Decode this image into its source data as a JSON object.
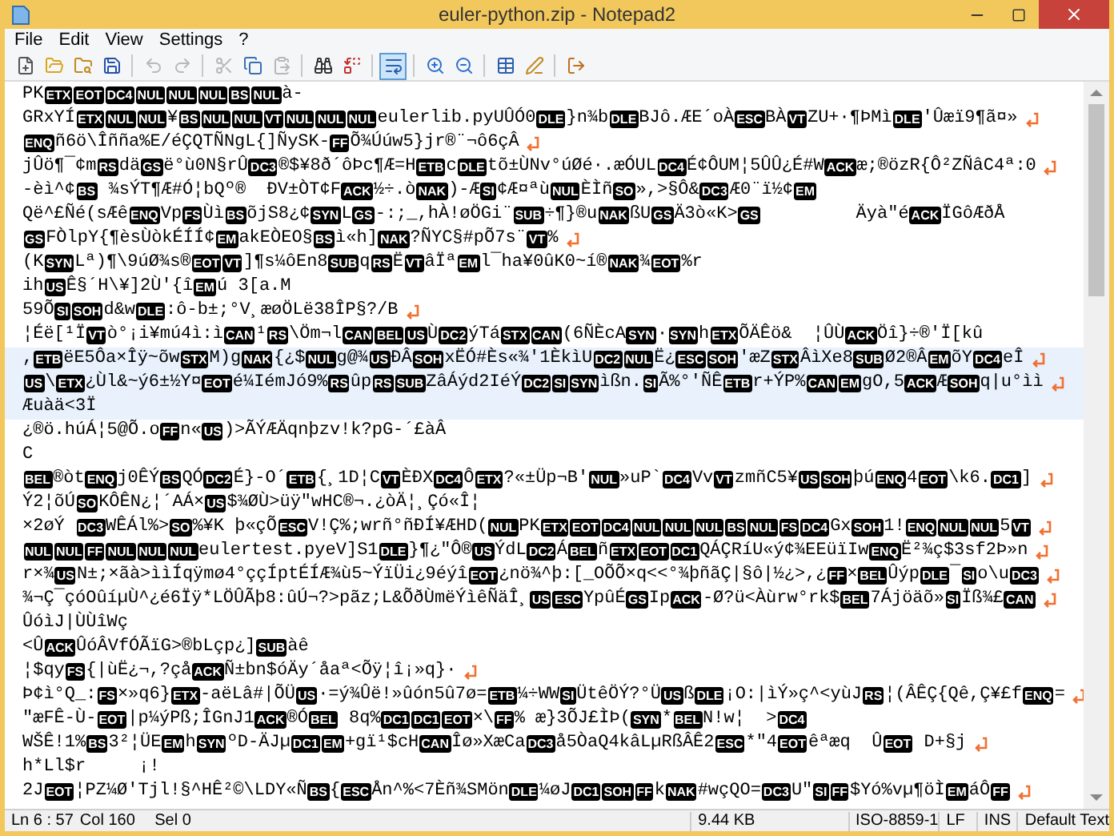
{
  "window": {
    "title": "euler-python.zip - Notepad2"
  },
  "menu": [
    {
      "label": "File"
    },
    {
      "label": "Edit"
    },
    {
      "label": "View"
    },
    {
      "label": "Settings"
    },
    {
      "label": "?"
    }
  ],
  "toolbar": [
    {
      "kind": "new",
      "pressed": false,
      "disabled": false
    },
    {
      "kind": "open",
      "pressed": false,
      "disabled": false
    },
    {
      "kind": "browse",
      "pressed": false,
      "disabled": false
    },
    {
      "kind": "save",
      "pressed": false,
      "disabled": false
    },
    {
      "kind": "sep"
    },
    {
      "kind": "undo",
      "pressed": false,
      "disabled": true
    },
    {
      "kind": "redo",
      "pressed": false,
      "disabled": true
    },
    {
      "kind": "sep"
    },
    {
      "kind": "cut",
      "pressed": false,
      "disabled": true
    },
    {
      "kind": "copy",
      "pressed": false,
      "disabled": false
    },
    {
      "kind": "paste",
      "pressed": false,
      "disabled": true
    },
    {
      "kind": "sep"
    },
    {
      "kind": "find",
      "pressed": false,
      "disabled": false
    },
    {
      "kind": "replace",
      "pressed": false,
      "disabled": false
    },
    {
      "kind": "sep"
    },
    {
      "kind": "wrap",
      "pressed": true,
      "disabled": false
    },
    {
      "kind": "sep"
    },
    {
      "kind": "zoomin",
      "pressed": false,
      "disabled": false
    },
    {
      "kind": "zoomout",
      "pressed": false,
      "disabled": false
    },
    {
      "kind": "sep"
    },
    {
      "kind": "schemes",
      "pressed": false,
      "disabled": false
    },
    {
      "kind": "customize",
      "pressed": false,
      "disabled": false
    },
    {
      "kind": "sep"
    },
    {
      "kind": "exit",
      "pressed": false,
      "disabled": false
    }
  ],
  "rows": [
    {
      "wrapped": false,
      "current": false,
      "parts": [
        {
          "kind": "text",
          "text": "PK"
        },
        {
          "kind": "control",
          "text": "ETX"
        },
        {
          "kind": "control",
          "text": "EOT"
        },
        {
          "kind": "control",
          "text": "DC4"
        },
        {
          "kind": "control",
          "text": "NUL"
        },
        {
          "kind": "control",
          "text": "NUL"
        },
        {
          "kind": "control",
          "text": "NUL"
        },
        {
          "kind": "control",
          "text": "BS"
        },
        {
          "kind": "control",
          "text": "NUL"
        },
        {
          "kind": "text",
          "text": "à-"
        }
      ]
    },
    {
      "wrapped": true,
      "current": false,
      "parts": [
        {
          "kind": "text",
          "text": "GRxYÍ"
        },
        {
          "kind": "control",
          "text": "ETX"
        },
        {
          "kind": "control",
          "text": "NUL"
        },
        {
          "kind": "control",
          "text": "NUL"
        },
        {
          "kind": "text",
          "text": "¥"
        },
        {
          "kind": "control",
          "text": "BS"
        },
        {
          "kind": "control",
          "text": "NUL"
        },
        {
          "kind": "control",
          "text": "NUL"
        },
        {
          "kind": "control",
          "text": "VT"
        },
        {
          "kind": "control",
          "text": "NUL"
        },
        {
          "kind": "control",
          "text": "NUL"
        },
        {
          "kind": "control",
          "text": "NUL"
        },
        {
          "kind": "text",
          "text": "eulerlib.pyUÛÓ0"
        },
        {
          "kind": "control",
          "text": "DLE"
        },
        {
          "kind": "text",
          "text": "}n¾b"
        },
        {
          "kind": "control",
          "text": "DLE"
        },
        {
          "kind": "text",
          "text": "BJô.ÆE´oÀ"
        },
        {
          "kind": "control",
          "text": "ESC"
        },
        {
          "kind": "text",
          "text": "BÀ"
        },
        {
          "kind": "control",
          "text": "VT"
        },
        {
          "kind": "text",
          "text": "ZU+·¶ÞMì"
        },
        {
          "kind": "control",
          "text": "DLE"
        },
        {
          "kind": "text",
          "text": "'Ûæï9¶ã¤»"
        }
      ]
    },
    {
      "wrapped": true,
      "current": false,
      "parts": [
        {
          "kind": "control",
          "text": "ENQ"
        },
        {
          "kind": "text",
          "text": "ñ6ö\\Îñña%E/éÇQTÑNgL{]ÑySK-"
        },
        {
          "kind": "control",
          "text": "FF"
        },
        {
          "kind": "text",
          "text": "Õ¾Úúw5}jr®¨¬ô6çÂ"
        }
      ]
    },
    {
      "wrapped": true,
      "current": false,
      "parts": [
        {
          "kind": "text",
          "text": "jÛö¶¯¢m"
        },
        {
          "kind": "control",
          "text": "RS"
        },
        {
          "kind": "text",
          "text": "dä"
        },
        {
          "kind": "control",
          "text": "GS"
        },
        {
          "kind": "text",
          "text": "ë°ù0N§rÛ"
        },
        {
          "kind": "control",
          "text": "DC3"
        },
        {
          "kind": "text",
          "text": "®$¥8ð´ôÞc¶Æ=H"
        },
        {
          "kind": "control",
          "text": "ETB"
        },
        {
          "kind": "text",
          "text": "c"
        },
        {
          "kind": "control",
          "text": "DLE"
        },
        {
          "kind": "text",
          "text": "tõ±ÙNv°úØé·.æÓUL"
        },
        {
          "kind": "control",
          "text": "DC4"
        },
        {
          "kind": "text",
          "text": "É¢ÔUM¦5ÛÛ¿É#W"
        },
        {
          "kind": "control",
          "text": "ACK"
        },
        {
          "kind": "text",
          "text": "æ;®özR{Ô²ZÑâC4ª:0"
        }
      ]
    },
    {
      "wrapped": false,
      "current": false,
      "parts": [
        {
          "kind": "text",
          "text": "-èì^¢"
        },
        {
          "kind": "control",
          "text": "BS"
        },
        {
          "kind": "text",
          "text": " ¾sÝT¶Æ#Ó¦bQº®  ÐV±ÒT¢F"
        },
        {
          "kind": "control",
          "text": "ACK"
        },
        {
          "kind": "text",
          "text": "½÷.ò"
        },
        {
          "kind": "control",
          "text": "NAK"
        },
        {
          "kind": "text",
          "text": ")-Æ"
        },
        {
          "kind": "control",
          "text": "SI"
        },
        {
          "kind": "text",
          "text": "¢Æ¤ªù"
        },
        {
          "kind": "control",
          "text": "NUL"
        },
        {
          "kind": "text",
          "text": "ÈÌñ"
        },
        {
          "kind": "control",
          "text": "SO"
        },
        {
          "kind": "text",
          "text": "»,>§Ô&"
        },
        {
          "kind": "control",
          "text": "DC3"
        },
        {
          "kind": "text",
          "text": "Æ0¨ï½¢"
        },
        {
          "kind": "control",
          "text": "EM"
        }
      ]
    },
    {
      "wrapped": false,
      "current": false,
      "parts": [
        {
          "kind": "text",
          "text": "Që^£Ñé(sÆê"
        },
        {
          "kind": "control",
          "text": "ENQ"
        },
        {
          "kind": "text",
          "text": "Vp"
        },
        {
          "kind": "control",
          "text": "FS"
        },
        {
          "kind": "text",
          "text": "Ùì"
        },
        {
          "kind": "control",
          "text": "BS"
        },
        {
          "kind": "text",
          "text": "õjS8¿¢"
        },
        {
          "kind": "control",
          "text": "SYN"
        },
        {
          "kind": "text",
          "text": "L"
        },
        {
          "kind": "control",
          "text": "GS"
        },
        {
          "kind": "text",
          "text": "-:;_,hÀ!øÖGi¨"
        },
        {
          "kind": "control",
          "text": "SUB"
        },
        {
          "kind": "text",
          "text": "÷¶}®u"
        },
        {
          "kind": "control",
          "text": "NAK"
        },
        {
          "kind": "text",
          "text": "ßU"
        },
        {
          "kind": "control",
          "text": "GS"
        },
        {
          "kind": "text",
          "text": "Ä3ò«K>"
        },
        {
          "kind": "control",
          "text": "GS"
        },
        {
          "kind": "text",
          "text": "         Äyà\"é"
        },
        {
          "kind": "control",
          "text": "ACK"
        },
        {
          "kind": "text",
          "text": "ÏGôÆðÅ"
        }
      ]
    },
    {
      "wrapped": true,
      "current": false,
      "parts": [
        {
          "kind": "control",
          "text": "GS"
        },
        {
          "kind": "text",
          "text": "FÒlpY{¶èsÙòkÉÍÍ¢"
        },
        {
          "kind": "control",
          "text": "EM"
        },
        {
          "kind": "text",
          "text": "akEÒEO§"
        },
        {
          "kind": "control",
          "text": "BS"
        },
        {
          "kind": "text",
          "text": "ì«h]"
        },
        {
          "kind": "control",
          "text": "NAK"
        },
        {
          "kind": "text",
          "text": "?ÑYC§#pÕ7s¨"
        },
        {
          "kind": "control",
          "text": "VT"
        },
        {
          "kind": "text",
          "text": "%"
        }
      ]
    },
    {
      "wrapped": false,
      "current": false,
      "parts": [
        {
          "kind": "text",
          "text": "(K"
        },
        {
          "kind": "control",
          "text": "SYN"
        },
        {
          "kind": "text",
          "text": "Lª)¶\\9úØ¾s®"
        },
        {
          "kind": "control",
          "text": "EOT"
        },
        {
          "kind": "control",
          "text": "VT"
        },
        {
          "kind": "text",
          "text": "]¶s¼ôEn8"
        },
        {
          "kind": "control",
          "text": "SUB"
        },
        {
          "kind": "text",
          "text": "q"
        },
        {
          "kind": "control",
          "text": "RS"
        },
        {
          "kind": "text",
          "text": "Ë"
        },
        {
          "kind": "control",
          "text": "VT"
        },
        {
          "kind": "text",
          "text": "âÏª"
        },
        {
          "kind": "control",
          "text": "EM"
        },
        {
          "kind": "text",
          "text": "l¯ha¥0ûK0~í®"
        },
        {
          "kind": "control",
          "text": "NAK"
        },
        {
          "kind": "text",
          "text": "¾"
        },
        {
          "kind": "control",
          "text": "EOT"
        },
        {
          "kind": "text",
          "text": "%r"
        }
      ]
    },
    {
      "wrapped": false,
      "current": false,
      "parts": [
        {
          "kind": "text",
          "text": "ih"
        },
        {
          "kind": "control",
          "text": "US"
        },
        {
          "kind": "text",
          "text": "Ê§´H\\¥]2Ù'{î"
        },
        {
          "kind": "control",
          "text": "EM"
        },
        {
          "kind": "text",
          "text": "ú 3[a.M"
        }
      ]
    },
    {
      "wrapped": true,
      "current": false,
      "parts": [
        {
          "kind": "text",
          "text": "59Õ"
        },
        {
          "kind": "control",
          "text": "SI"
        },
        {
          "kind": "control",
          "text": "SOH"
        },
        {
          "kind": "text",
          "text": "d&w"
        },
        {
          "kind": "control",
          "text": "DLE"
        },
        {
          "kind": "text",
          "text": ":ô-b±;°V¸æøÖLë38ÎP§?/B"
        }
      ]
    },
    {
      "wrapped": false,
      "current": false,
      "parts": [
        {
          "kind": "text",
          "text": "¦Éë[¹Ï"
        },
        {
          "kind": "control",
          "text": "VT"
        },
        {
          "kind": "text",
          "text": "ò°¡i¥mú4ì:ì"
        },
        {
          "kind": "control",
          "text": "CAN"
        },
        {
          "kind": "text",
          "text": "¹"
        },
        {
          "kind": "control",
          "text": "RS"
        },
        {
          "kind": "text",
          "text": "\\Öm¬l"
        },
        {
          "kind": "control",
          "text": "CAN"
        },
        {
          "kind": "control",
          "text": "BEL"
        },
        {
          "kind": "control",
          "text": "US"
        },
        {
          "kind": "text",
          "text": "Ù"
        },
        {
          "kind": "control",
          "text": "DC2"
        },
        {
          "kind": "text",
          "text": "ýTá"
        },
        {
          "kind": "control",
          "text": "STX"
        },
        {
          "kind": "control",
          "text": "CAN"
        },
        {
          "kind": "text",
          "text": "(6ÑÈcA"
        },
        {
          "kind": "control",
          "text": "SYN"
        },
        {
          "kind": "text",
          "text": "·"
        },
        {
          "kind": "control",
          "text": "SYN"
        },
        {
          "kind": "text",
          "text": "h"
        },
        {
          "kind": "control",
          "text": "ETX"
        },
        {
          "kind": "text",
          "text": "ÕÄÊö&  ¦ÛÙ"
        },
        {
          "kind": "control",
          "text": "ACK"
        },
        {
          "kind": "text",
          "text": "Öî}÷®'Ï[kû"
        }
      ]
    },
    {
      "wrapped": true,
      "current": true,
      "parts": [
        {
          "kind": "text",
          "text": ","
        },
        {
          "kind": "control",
          "text": "ETB"
        },
        {
          "kind": "text",
          "text": "ëE5Ôa×Îÿ~õw"
        },
        {
          "kind": "control",
          "text": "STX"
        },
        {
          "kind": "text",
          "text": "M)g"
        },
        {
          "kind": "control",
          "text": "NAK"
        },
        {
          "kind": "text",
          "text": "{¿$"
        },
        {
          "kind": "control",
          "text": "NUL"
        },
        {
          "kind": "text",
          "text": "g@¾"
        },
        {
          "kind": "control",
          "text": "US"
        },
        {
          "kind": "text",
          "text": "ÐÂ"
        },
        {
          "kind": "control",
          "text": "SOH"
        },
        {
          "kind": "text",
          "text": "xËÓ#Ès«¾'1ÈkìU"
        },
        {
          "kind": "control",
          "text": "DC2"
        },
        {
          "kind": "control",
          "text": "NUL"
        },
        {
          "kind": "text",
          "text": "Ë¿"
        },
        {
          "kind": "control",
          "text": "ESC"
        },
        {
          "kind": "control",
          "text": "SOH"
        },
        {
          "kind": "text",
          "text": "'æZ"
        },
        {
          "kind": "control",
          "text": "STX"
        },
        {
          "kind": "text",
          "text": "ÂìXe8"
        },
        {
          "kind": "control",
          "text": "SUB"
        },
        {
          "kind": "text",
          "text": "Ø2®Â"
        },
        {
          "kind": "control",
          "text": "EM"
        },
        {
          "kind": "text",
          "text": "õY"
        },
        {
          "kind": "control",
          "text": "DC4"
        },
        {
          "kind": "text",
          "text": "eÎ"
        }
      ]
    },
    {
      "wrapped": true,
      "current": true,
      "parts": [
        {
          "kind": "control",
          "text": "US"
        },
        {
          "kind": "text",
          "text": "\\"
        },
        {
          "kind": "control",
          "text": "ETX"
        },
        {
          "kind": "text",
          "text": "¿Ùl&~ý6±½Y¤"
        },
        {
          "kind": "control",
          "text": "EOT"
        },
        {
          "kind": "text",
          "text": "é¼IémJó9%"
        },
        {
          "kind": "control",
          "text": "RS"
        },
        {
          "kind": "text",
          "text": "ûp"
        },
        {
          "kind": "control",
          "text": "RS"
        },
        {
          "kind": "control",
          "text": "SUB"
        },
        {
          "kind": "text",
          "text": "ZâÁýd2IéÝ"
        },
        {
          "kind": "control",
          "text": "DC2"
        },
        {
          "kind": "control",
          "text": "SI"
        },
        {
          "kind": "control",
          "text": "SYN"
        },
        {
          "kind": "text",
          "text": "ìßn."
        },
        {
          "kind": "control",
          "text": "SI"
        },
        {
          "kind": "text",
          "text": "Ã%°'ÑÊ"
        },
        {
          "kind": "control",
          "text": "ETB"
        },
        {
          "kind": "text",
          "text": "r+ÝP%"
        },
        {
          "kind": "control",
          "text": "CAN"
        },
        {
          "kind": "control",
          "text": "EM"
        },
        {
          "kind": "text",
          "text": "gO,5"
        },
        {
          "kind": "control",
          "text": "ACK"
        },
        {
          "kind": "text",
          "text": "Æ"
        },
        {
          "kind": "control",
          "text": "SOH"
        },
        {
          "kind": "text",
          "text": "q|u°ìì"
        }
      ]
    },
    {
      "wrapped": false,
      "current": true,
      "parts": [
        {
          "kind": "text",
          "text": "Æuàä<3Ï"
        }
      ]
    },
    {
      "wrapped": false,
      "current": false,
      "parts": [
        {
          "kind": "text",
          "text": "¿®ö.húÁ¦5@Õ.o"
        },
        {
          "kind": "control",
          "text": "FF"
        },
        {
          "kind": "text",
          "text": "n«"
        },
        {
          "kind": "control",
          "text": "US"
        },
        {
          "kind": "text",
          "text": ")>ÃÝÆÄqnþzv!k?pG-´£àÂ"
        }
      ]
    },
    {
      "wrapped": false,
      "current": false,
      "parts": [
        {
          "kind": "text",
          "text": "C"
        }
      ]
    },
    {
      "wrapped": true,
      "current": false,
      "parts": [
        {
          "kind": "control",
          "text": "BEL"
        },
        {
          "kind": "text",
          "text": "®òt"
        },
        {
          "kind": "control",
          "text": "ENQ"
        },
        {
          "kind": "text",
          "text": "j0ÊÝ"
        },
        {
          "kind": "control",
          "text": "BS"
        },
        {
          "kind": "text",
          "text": "QÓ"
        },
        {
          "kind": "control",
          "text": "DC2"
        },
        {
          "kind": "text",
          "text": "É}-O´"
        },
        {
          "kind": "control",
          "text": "ETB"
        },
        {
          "kind": "text",
          "text": "{¸1D¦C"
        },
        {
          "kind": "control",
          "text": "VT"
        },
        {
          "kind": "text",
          "text": "ÈÐX"
        },
        {
          "kind": "control",
          "text": "DC4"
        },
        {
          "kind": "text",
          "text": "Ô"
        },
        {
          "kind": "control",
          "text": "ETX"
        },
        {
          "kind": "text",
          "text": "?«±Üp¬B'"
        },
        {
          "kind": "control",
          "text": "NUL"
        },
        {
          "kind": "text",
          "text": "»uP`"
        },
        {
          "kind": "control",
          "text": "DC4"
        },
        {
          "kind": "text",
          "text": "Vv"
        },
        {
          "kind": "control",
          "text": "VT"
        },
        {
          "kind": "text",
          "text": "zmñC5¥"
        },
        {
          "kind": "control",
          "text": "US"
        },
        {
          "kind": "control",
          "text": "SOH"
        },
        {
          "kind": "text",
          "text": "þú"
        },
        {
          "kind": "control",
          "text": "ENQ"
        },
        {
          "kind": "text",
          "text": "4"
        },
        {
          "kind": "control",
          "text": "EOT"
        },
        {
          "kind": "text",
          "text": "\\k6."
        },
        {
          "kind": "control",
          "text": "DC1"
        },
        {
          "kind": "text",
          "text": "]"
        }
      ]
    },
    {
      "wrapped": false,
      "current": false,
      "parts": [
        {
          "kind": "text",
          "text": "Ý2¦õÚ"
        },
        {
          "kind": "control",
          "text": "SO"
        },
        {
          "kind": "text",
          "text": "KÔÊN¿¦´AÁ×"
        },
        {
          "kind": "control",
          "text": "US"
        },
        {
          "kind": "text",
          "text": "$¾ØÙ>üÿ\"wHC®¬.¿òÄ¦¸Çó«Î¦"
        }
      ]
    },
    {
      "wrapped": true,
      "current": false,
      "parts": [
        {
          "kind": "text",
          "text": "×2øÝ "
        },
        {
          "kind": "control",
          "text": "DC3"
        },
        {
          "kind": "text",
          "text": "WÊÁl%>"
        },
        {
          "kind": "control",
          "text": "SO"
        },
        {
          "kind": "text",
          "text": "%¥K þ«çÕ"
        },
        {
          "kind": "control",
          "text": "ESC"
        },
        {
          "kind": "text",
          "text": "V!Ç%;wrñ°ñÐÍ¥ÆHD("
        },
        {
          "kind": "control",
          "text": "NUL"
        },
        {
          "kind": "text",
          "text": "PK"
        },
        {
          "kind": "control",
          "text": "ETX"
        },
        {
          "kind": "control",
          "text": "EOT"
        },
        {
          "kind": "control",
          "text": "DC4"
        },
        {
          "kind": "control",
          "text": "NUL"
        },
        {
          "kind": "control",
          "text": "NUL"
        },
        {
          "kind": "control",
          "text": "NUL"
        },
        {
          "kind": "control",
          "text": "BS"
        },
        {
          "kind": "control",
          "text": "NUL"
        },
        {
          "kind": "control",
          "text": "FS"
        },
        {
          "kind": "control",
          "text": "DC4"
        },
        {
          "kind": "text",
          "text": "Gx"
        },
        {
          "kind": "control",
          "text": "SOH"
        },
        {
          "kind": "text",
          "text": "1!"
        },
        {
          "kind": "control",
          "text": "ENQ"
        },
        {
          "kind": "control",
          "text": "NUL"
        },
        {
          "kind": "control",
          "text": "NUL"
        },
        {
          "kind": "text",
          "text": "5"
        },
        {
          "kind": "control",
          "text": "VT"
        }
      ]
    },
    {
      "wrapped": true,
      "current": false,
      "parts": [
        {
          "kind": "control",
          "text": "NUL"
        },
        {
          "kind": "control",
          "text": "NUL"
        },
        {
          "kind": "control",
          "text": "FF"
        },
        {
          "kind": "control",
          "text": "NUL"
        },
        {
          "kind": "control",
          "text": "NUL"
        },
        {
          "kind": "control",
          "text": "NUL"
        },
        {
          "kind": "text",
          "text": "eulertest.pyeV]S1"
        },
        {
          "kind": "control",
          "text": "DLE"
        },
        {
          "kind": "text",
          "text": "}¶¿\"Ô®"
        },
        {
          "kind": "control",
          "text": "US"
        },
        {
          "kind": "text",
          "text": "ÝdL"
        },
        {
          "kind": "control",
          "text": "DC2"
        },
        {
          "kind": "text",
          "text": "Á"
        },
        {
          "kind": "control",
          "text": "BEL"
        },
        {
          "kind": "text",
          "text": "ñ"
        },
        {
          "kind": "control",
          "text": "ETX"
        },
        {
          "kind": "control",
          "text": "EOT"
        },
        {
          "kind": "control",
          "text": "DC1"
        },
        {
          "kind": "text",
          "text": "QÁÇRíU«ý¢¾EEüïIw"
        },
        {
          "kind": "control",
          "text": "ENQ"
        },
        {
          "kind": "text",
          "text": "Ë²¾ç$3sf2Þ»n"
        }
      ]
    },
    {
      "wrapped": true,
      "current": false,
      "parts": [
        {
          "kind": "text",
          "text": "r×¾"
        },
        {
          "kind": "control",
          "text": "US"
        },
        {
          "kind": "text",
          "text": "N±;×ãà>ììÍqÿmø4°ççÍptÉÍÆ¾ù5~ÝïÜi¿9éýî"
        },
        {
          "kind": "control",
          "text": "EOT"
        },
        {
          "kind": "text",
          "text": "¿nö¾^þ:[_OÕÕ×q<<°¾þñãÇ|§ô|½¿>,¿"
        },
        {
          "kind": "control",
          "text": "FF"
        },
        {
          "kind": "text",
          "text": "×"
        },
        {
          "kind": "control",
          "text": "BEL"
        },
        {
          "kind": "text",
          "text": "Ûýp"
        },
        {
          "kind": "control",
          "text": "DLE"
        },
        {
          "kind": "text",
          "text": "¯"
        },
        {
          "kind": "control",
          "text": "SI"
        },
        {
          "kind": "text",
          "text": "o\\u"
        },
        {
          "kind": "control",
          "text": "DC3"
        }
      ]
    },
    {
      "wrapped": true,
      "current": false,
      "parts": [
        {
          "kind": "text",
          "text": "¾¬Ç¯çóOûíµÙ^¿é6Ïÿ*LÖÛÃþ8:ûÚ¬?>pãz;L&ÕðÙmëÝìêÑäÎ¸"
        },
        {
          "kind": "control",
          "text": "US"
        },
        {
          "kind": "control",
          "text": "ESC"
        },
        {
          "kind": "text",
          "text": "YpûÉ"
        },
        {
          "kind": "control",
          "text": "GS"
        },
        {
          "kind": "text",
          "text": "Ip"
        },
        {
          "kind": "control",
          "text": "ACK"
        },
        {
          "kind": "text",
          "text": "-Ø?ü<Àùrw°rk$"
        },
        {
          "kind": "control",
          "text": "BEL"
        },
        {
          "kind": "text",
          "text": "7Ájöäõ»"
        },
        {
          "kind": "control",
          "text": "SI"
        },
        {
          "kind": "text",
          "text": "Ïß¾£"
        },
        {
          "kind": "control",
          "text": "CAN"
        }
      ]
    },
    {
      "wrapped": false,
      "current": false,
      "parts": [
        {
          "kind": "text",
          "text": "ÛóìJ|ÙÙîWç"
        }
      ]
    },
    {
      "wrapped": false,
      "current": false,
      "parts": [
        {
          "kind": "text",
          "text": "<Û"
        },
        {
          "kind": "control",
          "text": "ACK"
        },
        {
          "kind": "text",
          "text": "ÛóÂVfÓÃïG>®bLçp¿]"
        },
        {
          "kind": "control",
          "text": "SUB"
        },
        {
          "kind": "text",
          "text": "àê"
        }
      ]
    },
    {
      "wrapped": true,
      "current": false,
      "parts": [
        {
          "kind": "text",
          "text": "¦$qy"
        },
        {
          "kind": "control",
          "text": "FS"
        },
        {
          "kind": "text",
          "text": "{|ùË¿¬,?çå"
        },
        {
          "kind": "control",
          "text": "ACK"
        },
        {
          "kind": "text",
          "text": "Ñ±bn$óÄy´åaª<Õÿ¦î¡»q}·"
        }
      ]
    },
    {
      "wrapped": true,
      "current": false,
      "parts": [
        {
          "kind": "text",
          "text": "Þ¢ì°Q_:"
        },
        {
          "kind": "control",
          "text": "FS"
        },
        {
          "kind": "text",
          "text": "×»q6}"
        },
        {
          "kind": "control",
          "text": "ETX"
        },
        {
          "kind": "text",
          "text": "-aëLâ#|ÕÜ"
        },
        {
          "kind": "control",
          "text": "US"
        },
        {
          "kind": "text",
          "text": "·=ý¾Ûë!»ûón5û7ø="
        },
        {
          "kind": "control",
          "text": "ETB"
        },
        {
          "kind": "text",
          "text": "¼÷WW"
        },
        {
          "kind": "control",
          "text": "SI"
        },
        {
          "kind": "text",
          "text": "ÜtêÖÝ?°Ü"
        },
        {
          "kind": "control",
          "text": "US"
        },
        {
          "kind": "text",
          "text": "ß"
        },
        {
          "kind": "control",
          "text": "DLE"
        },
        {
          "kind": "text",
          "text": "¡O:|ìÝ»ç^<yùJ"
        },
        {
          "kind": "control",
          "text": "RS"
        },
        {
          "kind": "text",
          "text": "¦(ÂÊÇ{Qê,Ç¥£f"
        },
        {
          "kind": "control",
          "text": "ENQ"
        },
        {
          "kind": "text",
          "text": "="
        }
      ]
    },
    {
      "wrapped": false,
      "current": false,
      "parts": [
        {
          "kind": "text",
          "text": "\"æFÊ-Ù-"
        },
        {
          "kind": "control",
          "text": "EOT"
        },
        {
          "kind": "text",
          "text": "|p¼ýPß;ÎGnJ1"
        },
        {
          "kind": "control",
          "text": "ACK"
        },
        {
          "kind": "text",
          "text": "®Ó"
        },
        {
          "kind": "control",
          "text": "BEL"
        },
        {
          "kind": "text",
          "text": " 8q%"
        },
        {
          "kind": "control",
          "text": "DC1"
        },
        {
          "kind": "control",
          "text": "DC1"
        },
        {
          "kind": "control",
          "text": "EOT"
        },
        {
          "kind": "text",
          "text": "×\\"
        },
        {
          "kind": "control",
          "text": "FF"
        },
        {
          "kind": "text",
          "text": "% æ}3ÕJ£ÌÞ("
        },
        {
          "kind": "control",
          "text": "SYN"
        },
        {
          "kind": "text",
          "text": "*"
        },
        {
          "kind": "control",
          "text": "BEL"
        },
        {
          "kind": "text",
          "text": "N!w¦  >"
        },
        {
          "kind": "control",
          "text": "DC4"
        }
      ]
    },
    {
      "wrapped": true,
      "current": false,
      "parts": [
        {
          "kind": "text",
          "text": "WŠÊ!1%"
        },
        {
          "kind": "control",
          "text": "BS"
        },
        {
          "kind": "text",
          "text": "3²¦ÜE"
        },
        {
          "kind": "control",
          "text": "EM"
        },
        {
          "kind": "text",
          "text": "h"
        },
        {
          "kind": "control",
          "text": "SYN"
        },
        {
          "kind": "text",
          "text": "ºD-ÄJµ"
        },
        {
          "kind": "control",
          "text": "DC1"
        },
        {
          "kind": "control",
          "text": "EM"
        },
        {
          "kind": "text",
          "text": "+gï¹$cH"
        },
        {
          "kind": "control",
          "text": "CAN"
        },
        {
          "kind": "text",
          "text": "Îø»XæCa"
        },
        {
          "kind": "control",
          "text": "DC3"
        },
        {
          "kind": "text",
          "text": "å5ÒaQ4kâLµRßÂÊ2"
        },
        {
          "kind": "control",
          "text": "ESC"
        },
        {
          "kind": "text",
          "text": "*\"4"
        },
        {
          "kind": "control",
          "text": "EOT"
        },
        {
          "kind": "text",
          "text": "êªæq  Û"
        },
        {
          "kind": "control",
          "text": "EOT"
        },
        {
          "kind": "text",
          "text": " D+§j"
        }
      ]
    },
    {
      "wrapped": false,
      "current": false,
      "parts": [
        {
          "kind": "text",
          "text": "h*Ll$r     ¡!"
        }
      ]
    },
    {
      "wrapped": true,
      "current": false,
      "parts": [
        {
          "kind": "text",
          "text": "2J"
        },
        {
          "kind": "control",
          "text": "EOT"
        },
        {
          "kind": "text",
          "text": "¦PZ¼Ø'Tjl!§^HÊ²©\\LDY«Ñ"
        },
        {
          "kind": "control",
          "text": "BS"
        },
        {
          "kind": "text",
          "text": "{"
        },
        {
          "kind": "control",
          "text": "ESC"
        },
        {
          "kind": "text",
          "text": "Ån^%<7Èñ¾SMön"
        },
        {
          "kind": "control",
          "text": "DLE"
        },
        {
          "kind": "text",
          "text": "¼øJ"
        },
        {
          "kind": "control",
          "text": "DC1"
        },
        {
          "kind": "control",
          "text": "SOH"
        },
        {
          "kind": "control",
          "text": "FF"
        },
        {
          "kind": "text",
          "text": "k"
        },
        {
          "kind": "control",
          "text": "NAK"
        },
        {
          "kind": "text",
          "text": "#wçQO="
        },
        {
          "kind": "control",
          "text": "DC3"
        },
        {
          "kind": "text",
          "text": "U\""
        },
        {
          "kind": "control",
          "text": "SI"
        },
        {
          "kind": "control",
          "text": "FF"
        },
        {
          "kind": "text",
          "text": "$Yó%vµ¶öÌ"
        },
        {
          "kind": "control",
          "text": "EM"
        },
        {
          "kind": "text",
          "text": "áÔ"
        },
        {
          "kind": "control",
          "text": "FF"
        }
      ]
    }
  ],
  "status_bar": [
    {
      "text": "Ln 6 : 57"
    },
    {
      "text": "Col 160"
    },
    {
      "text": "Sel 0"
    },
    {
      "text": "9.44 KB"
    },
    {
      "text": "ISO-8859-1"
    },
    {
      "text": "LF"
    },
    {
      "text": "INS"
    },
    {
      "text": "Default Text"
    }
  ]
}
